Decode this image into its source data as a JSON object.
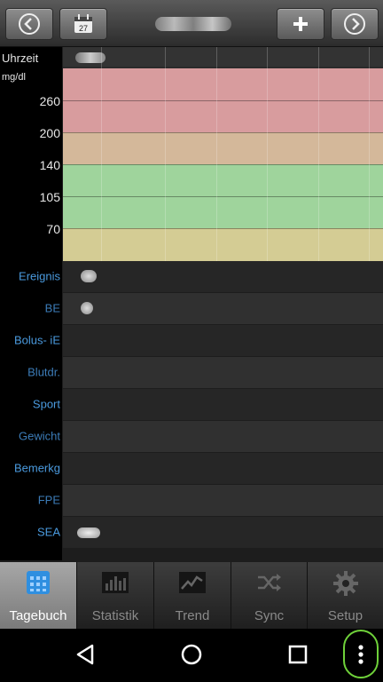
{
  "topbar": {
    "back_icon": "chevron-left-icon",
    "calendar_icon": "calendar-icon",
    "calendar_day": "27",
    "add_icon": "plus-icon",
    "forward_icon": "chevron-right-icon"
  },
  "chart": {
    "header_label": "Uhrzeit",
    "unit_label": "mg/dl",
    "y_ticks": [
      "260",
      "200",
      "140",
      "105",
      "70"
    ],
    "zone_colors": {
      "very_high": "#d89c9e",
      "high": "#d4b89a",
      "target": "#9fd49c",
      "low": "#d4cc94"
    }
  },
  "rows": [
    {
      "label": "Ereignis",
      "has_icon": true
    },
    {
      "label": "BE",
      "has_icon": true
    },
    {
      "label": "Bolus- iE",
      "has_icon": false
    },
    {
      "label": "Blutdr.",
      "has_icon": false
    },
    {
      "label": "Sport",
      "has_icon": false
    },
    {
      "label": "Gewicht",
      "has_icon": false
    },
    {
      "label": "Bemerkg",
      "has_icon": false
    },
    {
      "label": "FPE",
      "has_icon": false
    },
    {
      "label": "SEA",
      "has_icon": true
    }
  ],
  "tabs": [
    {
      "label": "Tagebuch",
      "icon": "calendar-grid-icon",
      "active": true
    },
    {
      "label": "Statistik",
      "icon": "bar-chart-icon",
      "active": false
    },
    {
      "label": "Trend",
      "icon": "trend-line-icon",
      "active": false
    },
    {
      "label": "Sync",
      "icon": "shuffle-icon",
      "active": false
    },
    {
      "label": "Setup",
      "icon": "gear-icon",
      "active": false
    }
  ],
  "navbar": {
    "back": "nav-back-icon",
    "home": "nav-home-icon",
    "recents": "nav-recents-icon",
    "overflow": "overflow-menu-icon"
  }
}
